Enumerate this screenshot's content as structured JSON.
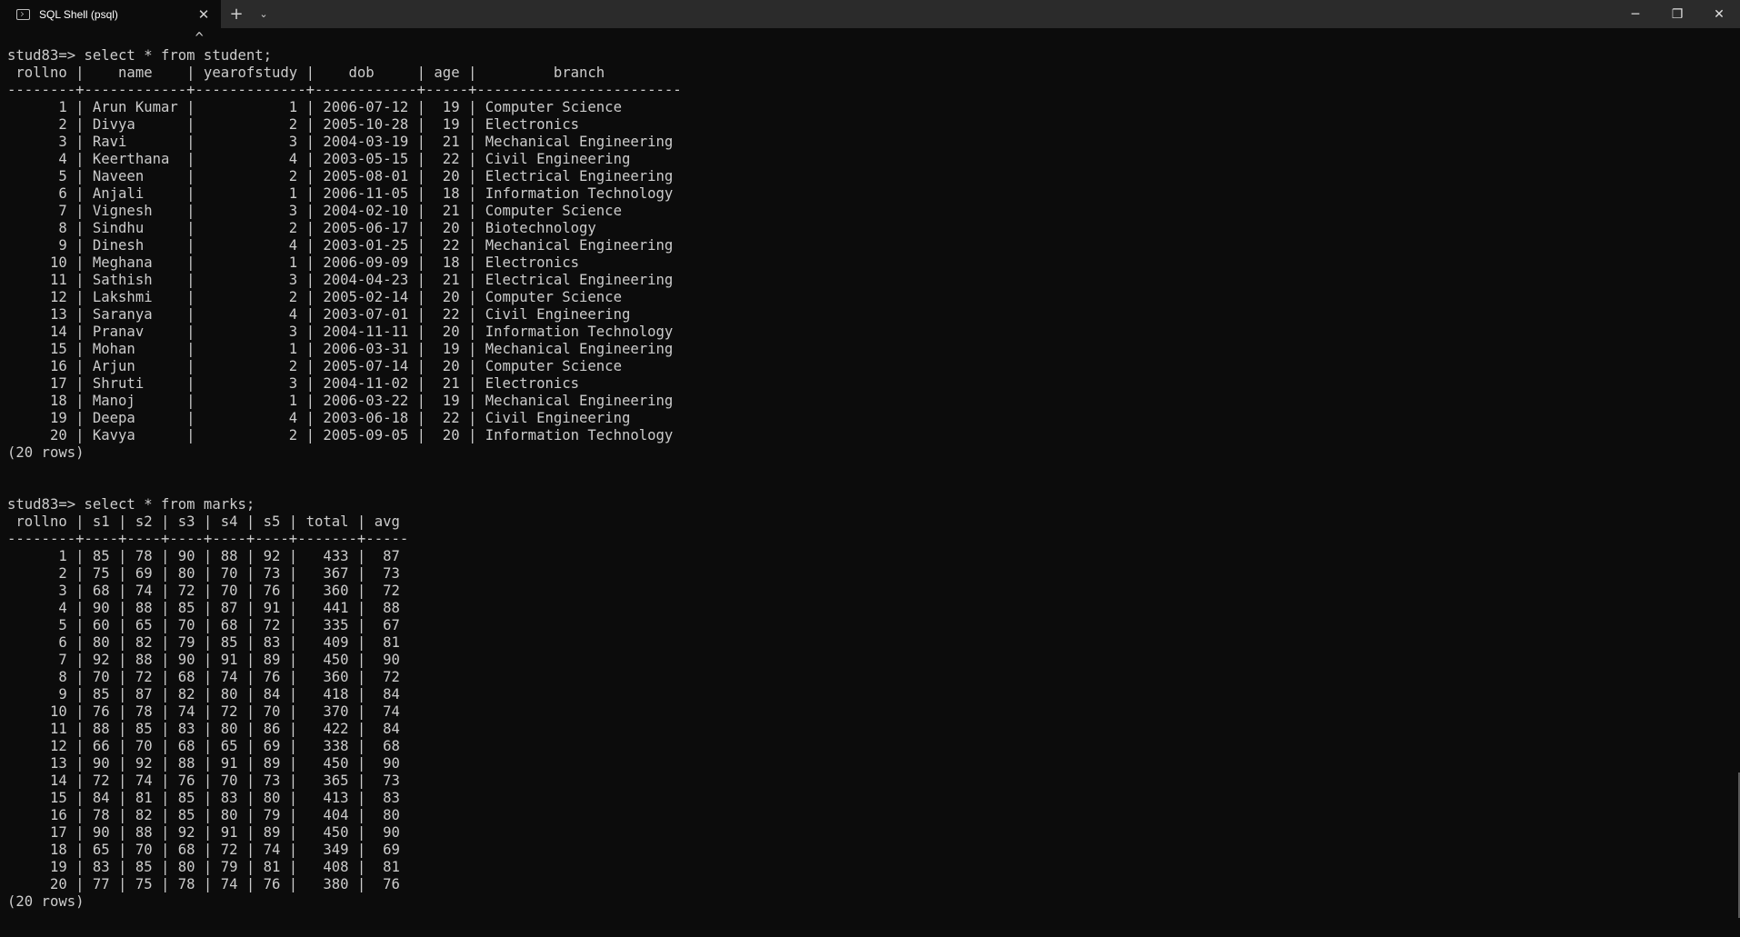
{
  "window": {
    "tab_title": "SQL Shell (psql)",
    "tab_icon": "terminal-icon",
    "close_tab_glyph": "✕",
    "new_tab_glyph": "+",
    "dropdown_glyph": "⌄",
    "minimize_glyph": "─",
    "restore_glyph": "❐",
    "close_glyph": "✕"
  },
  "terminal": {
    "lines": [
      "                      ^",
      "stud83=> select * from student;",
      " rollno |    name    | yearofstudy |    dob     | age |         branch",
      "--------+------------+-------------+------------+-----+------------------------",
      "      1 | Arun Kumar |           1 | 2006-07-12 |  19 | Computer Science",
      "      2 | Divya      |           2 | 2005-10-28 |  19 | Electronics",
      "      3 | Ravi       |           3 | 2004-03-19 |  21 | Mechanical Engineering",
      "      4 | Keerthana  |           4 | 2003-05-15 |  22 | Civil Engineering",
      "      5 | Naveen     |           2 | 2005-08-01 |  20 | Electrical Engineering",
      "      6 | Anjali     |           1 | 2006-11-05 |  18 | Information Technology",
      "      7 | Vignesh    |           3 | 2004-02-10 |  21 | Computer Science",
      "      8 | Sindhu     |           2 | 2005-06-17 |  20 | Biotechnology",
      "      9 | Dinesh     |           4 | 2003-01-25 |  22 | Mechanical Engineering",
      "     10 | Meghana    |           1 | 2006-09-09 |  18 | Electronics",
      "     11 | Sathish    |           3 | 2004-04-23 |  21 | Electrical Engineering",
      "     12 | Lakshmi    |           2 | 2005-02-14 |  20 | Computer Science",
      "     13 | Saranya    |           4 | 2003-07-01 |  22 | Civil Engineering",
      "     14 | Pranav     |           3 | 2004-11-11 |  20 | Information Technology",
      "     15 | Mohan      |           1 | 2006-03-31 |  19 | Mechanical Engineering",
      "     16 | Arjun      |           2 | 2005-07-14 |  20 | Computer Science",
      "     17 | Shruti     |           3 | 2004-11-02 |  21 | Electronics",
      "     18 | Manoj      |           1 | 2006-03-22 |  19 | Mechanical Engineering",
      "     19 | Deepa      |           4 | 2003-06-18 |  22 | Civil Engineering",
      "     20 | Kavya      |           2 | 2005-09-05 |  20 | Information Technology",
      "(20 rows)",
      "",
      "",
      "stud83=> select * from marks;",
      " rollno | s1 | s2 | s3 | s4 | s5 | total | avg",
      "--------+----+----+----+----+----+-------+-----",
      "      1 | 85 | 78 | 90 | 88 | 92 |   433 |  87",
      "      2 | 75 | 69 | 80 | 70 | 73 |   367 |  73",
      "      3 | 68 | 74 | 72 | 70 | 76 |   360 |  72",
      "      4 | 90 | 88 | 85 | 87 | 91 |   441 |  88",
      "      5 | 60 | 65 | 70 | 68 | 72 |   335 |  67",
      "      6 | 80 | 82 | 79 | 85 | 83 |   409 |  81",
      "      7 | 92 | 88 | 90 | 91 | 89 |   450 |  90",
      "      8 | 70 | 72 | 68 | 74 | 76 |   360 |  72",
      "      9 | 85 | 87 | 82 | 80 | 84 |   418 |  84",
      "     10 | 76 | 78 | 74 | 72 | 70 |   370 |  74",
      "     11 | 88 | 85 | 83 | 80 | 86 |   422 |  84",
      "     12 | 66 | 70 | 68 | 65 | 69 |   338 |  68",
      "     13 | 90 | 92 | 88 | 91 | 89 |   450 |  90",
      "     14 | 72 | 74 | 76 | 70 | 73 |   365 |  73",
      "     15 | 84 | 81 | 85 | 83 | 80 |   413 |  83",
      "     16 | 78 | 82 | 85 | 80 | 79 |   404 |  80",
      "     17 | 90 | 88 | 92 | 91 | 89 |   450 |  90",
      "     18 | 65 | 70 | 68 | 72 | 74 |   349 |  69",
      "     19 | 83 | 85 | 80 | 79 | 81 |   408 |  81",
      "     20 | 77 | 75 | 78 | 74 | 76 |   380 |  76",
      "(20 rows)"
    ]
  },
  "colors": {
    "terminal_bg": "#0c0c0c",
    "titlebar_bg": "#2b2b2b",
    "text": "#cccccc"
  }
}
